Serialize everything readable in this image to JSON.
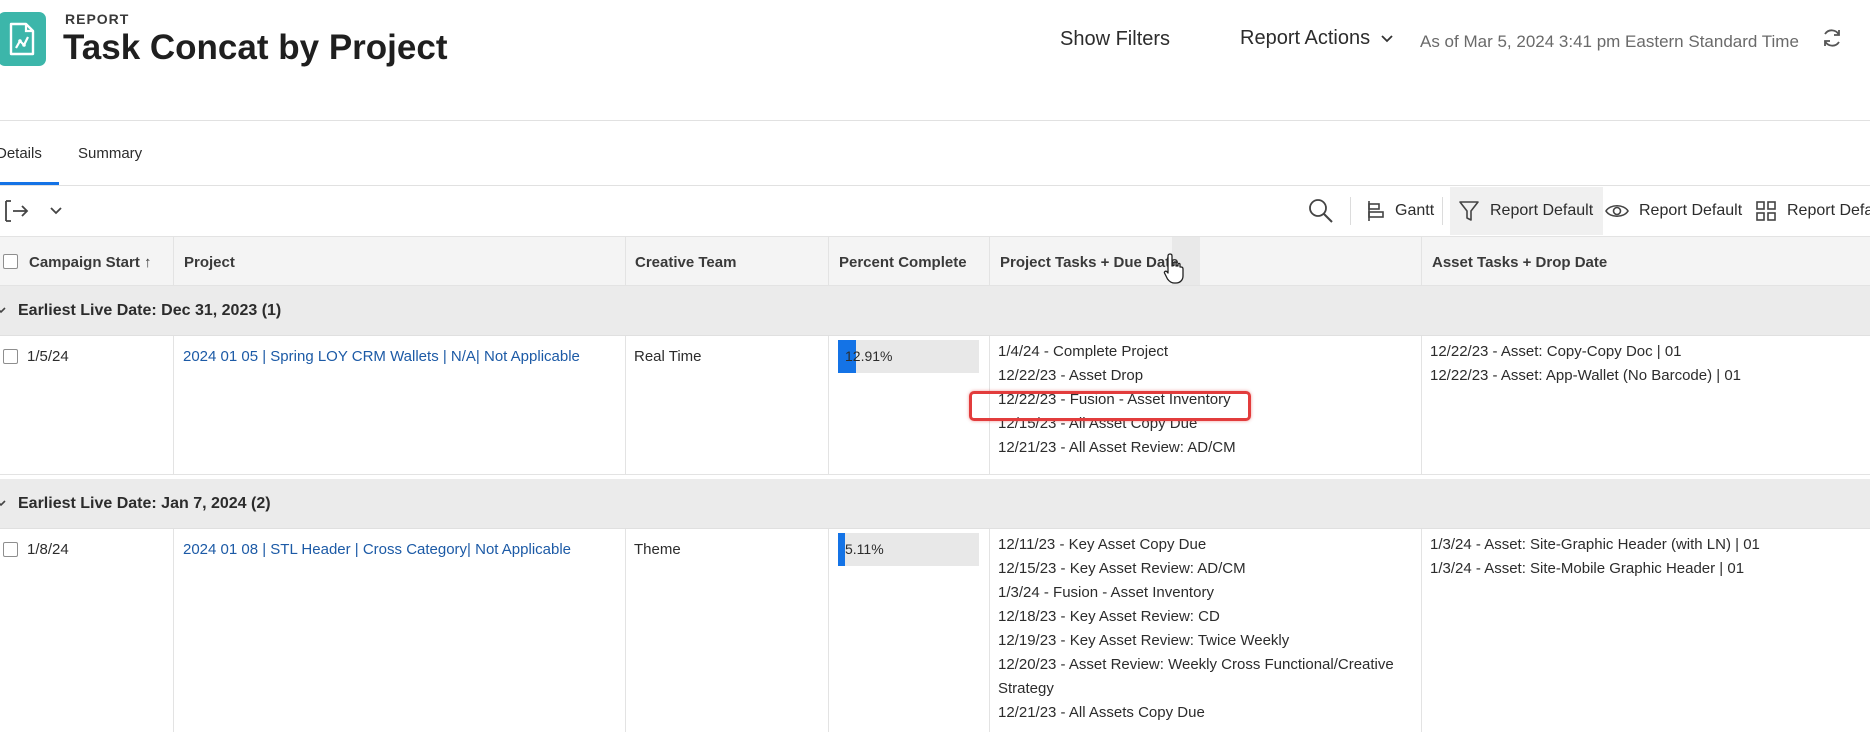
{
  "header": {
    "kicker": "REPORT",
    "title": "Task Concat by Project",
    "show_filters": "Show Filters",
    "report_actions": "Report Actions",
    "as_of": "As of Mar 5, 2024 3:41 pm Eastern Standard Time"
  },
  "tabs": [
    {
      "label": "Details",
      "active": true
    },
    {
      "label": "Summary",
      "active": false
    }
  ],
  "toolbar": {
    "gantt": "Gantt",
    "filter": "Report Default",
    "view": "Report Default",
    "grouping": "Report Defau"
  },
  "columns": [
    {
      "label": "Campaign Start ↑"
    },
    {
      "label": "Project"
    },
    {
      "label": "Creative Team"
    },
    {
      "label": "Percent Complete"
    },
    {
      "label": "Project Tasks + Due Date"
    },
    {
      "label": "Asset Tasks + Drop Date"
    }
  ],
  "groups": [
    {
      "label": "Earliest Live Date: Dec 31, 2023 (1)",
      "row": {
        "campaign_start": "1/5/24",
        "project": "2024 01 05 | Spring LOY CRM Wallets | N/A| Not Applicable",
        "creative_team": "Real Time",
        "percent_complete": "12.91%",
        "percent_value": 12.91,
        "project_tasks": [
          "1/4/24 - Complete Project",
          "12/22/23 - Asset Drop",
          "12/22/23 - Fusion - Asset Inventory",
          "12/15/23 - All Asset Copy Due",
          "12/21/23 - All Asset Review: AD/CM"
        ],
        "asset_tasks": [
          "12/22/23 - Asset: Copy-Copy Doc | 01",
          "12/22/23 - Asset: App-Wallet (No Barcode) | 01"
        ]
      }
    },
    {
      "label": "Earliest Live Date: Jan 7, 2024 (2)",
      "row": {
        "campaign_start": "1/8/24",
        "project": "2024 01 08 | STL Header | Cross Category| Not Applicable",
        "creative_team": "Theme",
        "percent_complete": "5.11%",
        "percent_value": 5.11,
        "project_tasks": [
          "12/11/23 - Key Asset Copy Due",
          "12/15/23 - Key Asset Review: AD/CM",
          "1/3/24 - Fusion - Asset Inventory",
          "12/18/23 - Key Asset Review: CD",
          "12/19/23 - Key Asset Review: Twice Weekly",
          "12/20/23 - Asset Review: Weekly Cross Functional/Creative",
          "Strategy",
          "12/21/23 - All Assets Copy Due"
        ],
        "asset_tasks": [
          "1/3/24 - Asset: Site-Graphic Header (with LN) | 01",
          "1/3/24 - Asset: Site-Mobile Graphic Header | 01"
        ]
      }
    }
  ],
  "colors": {
    "accent": "#1473e6",
    "icon_bg": "#3cb6aa",
    "link": "#1c5aa6",
    "highlight": "#e23c3c"
  }
}
